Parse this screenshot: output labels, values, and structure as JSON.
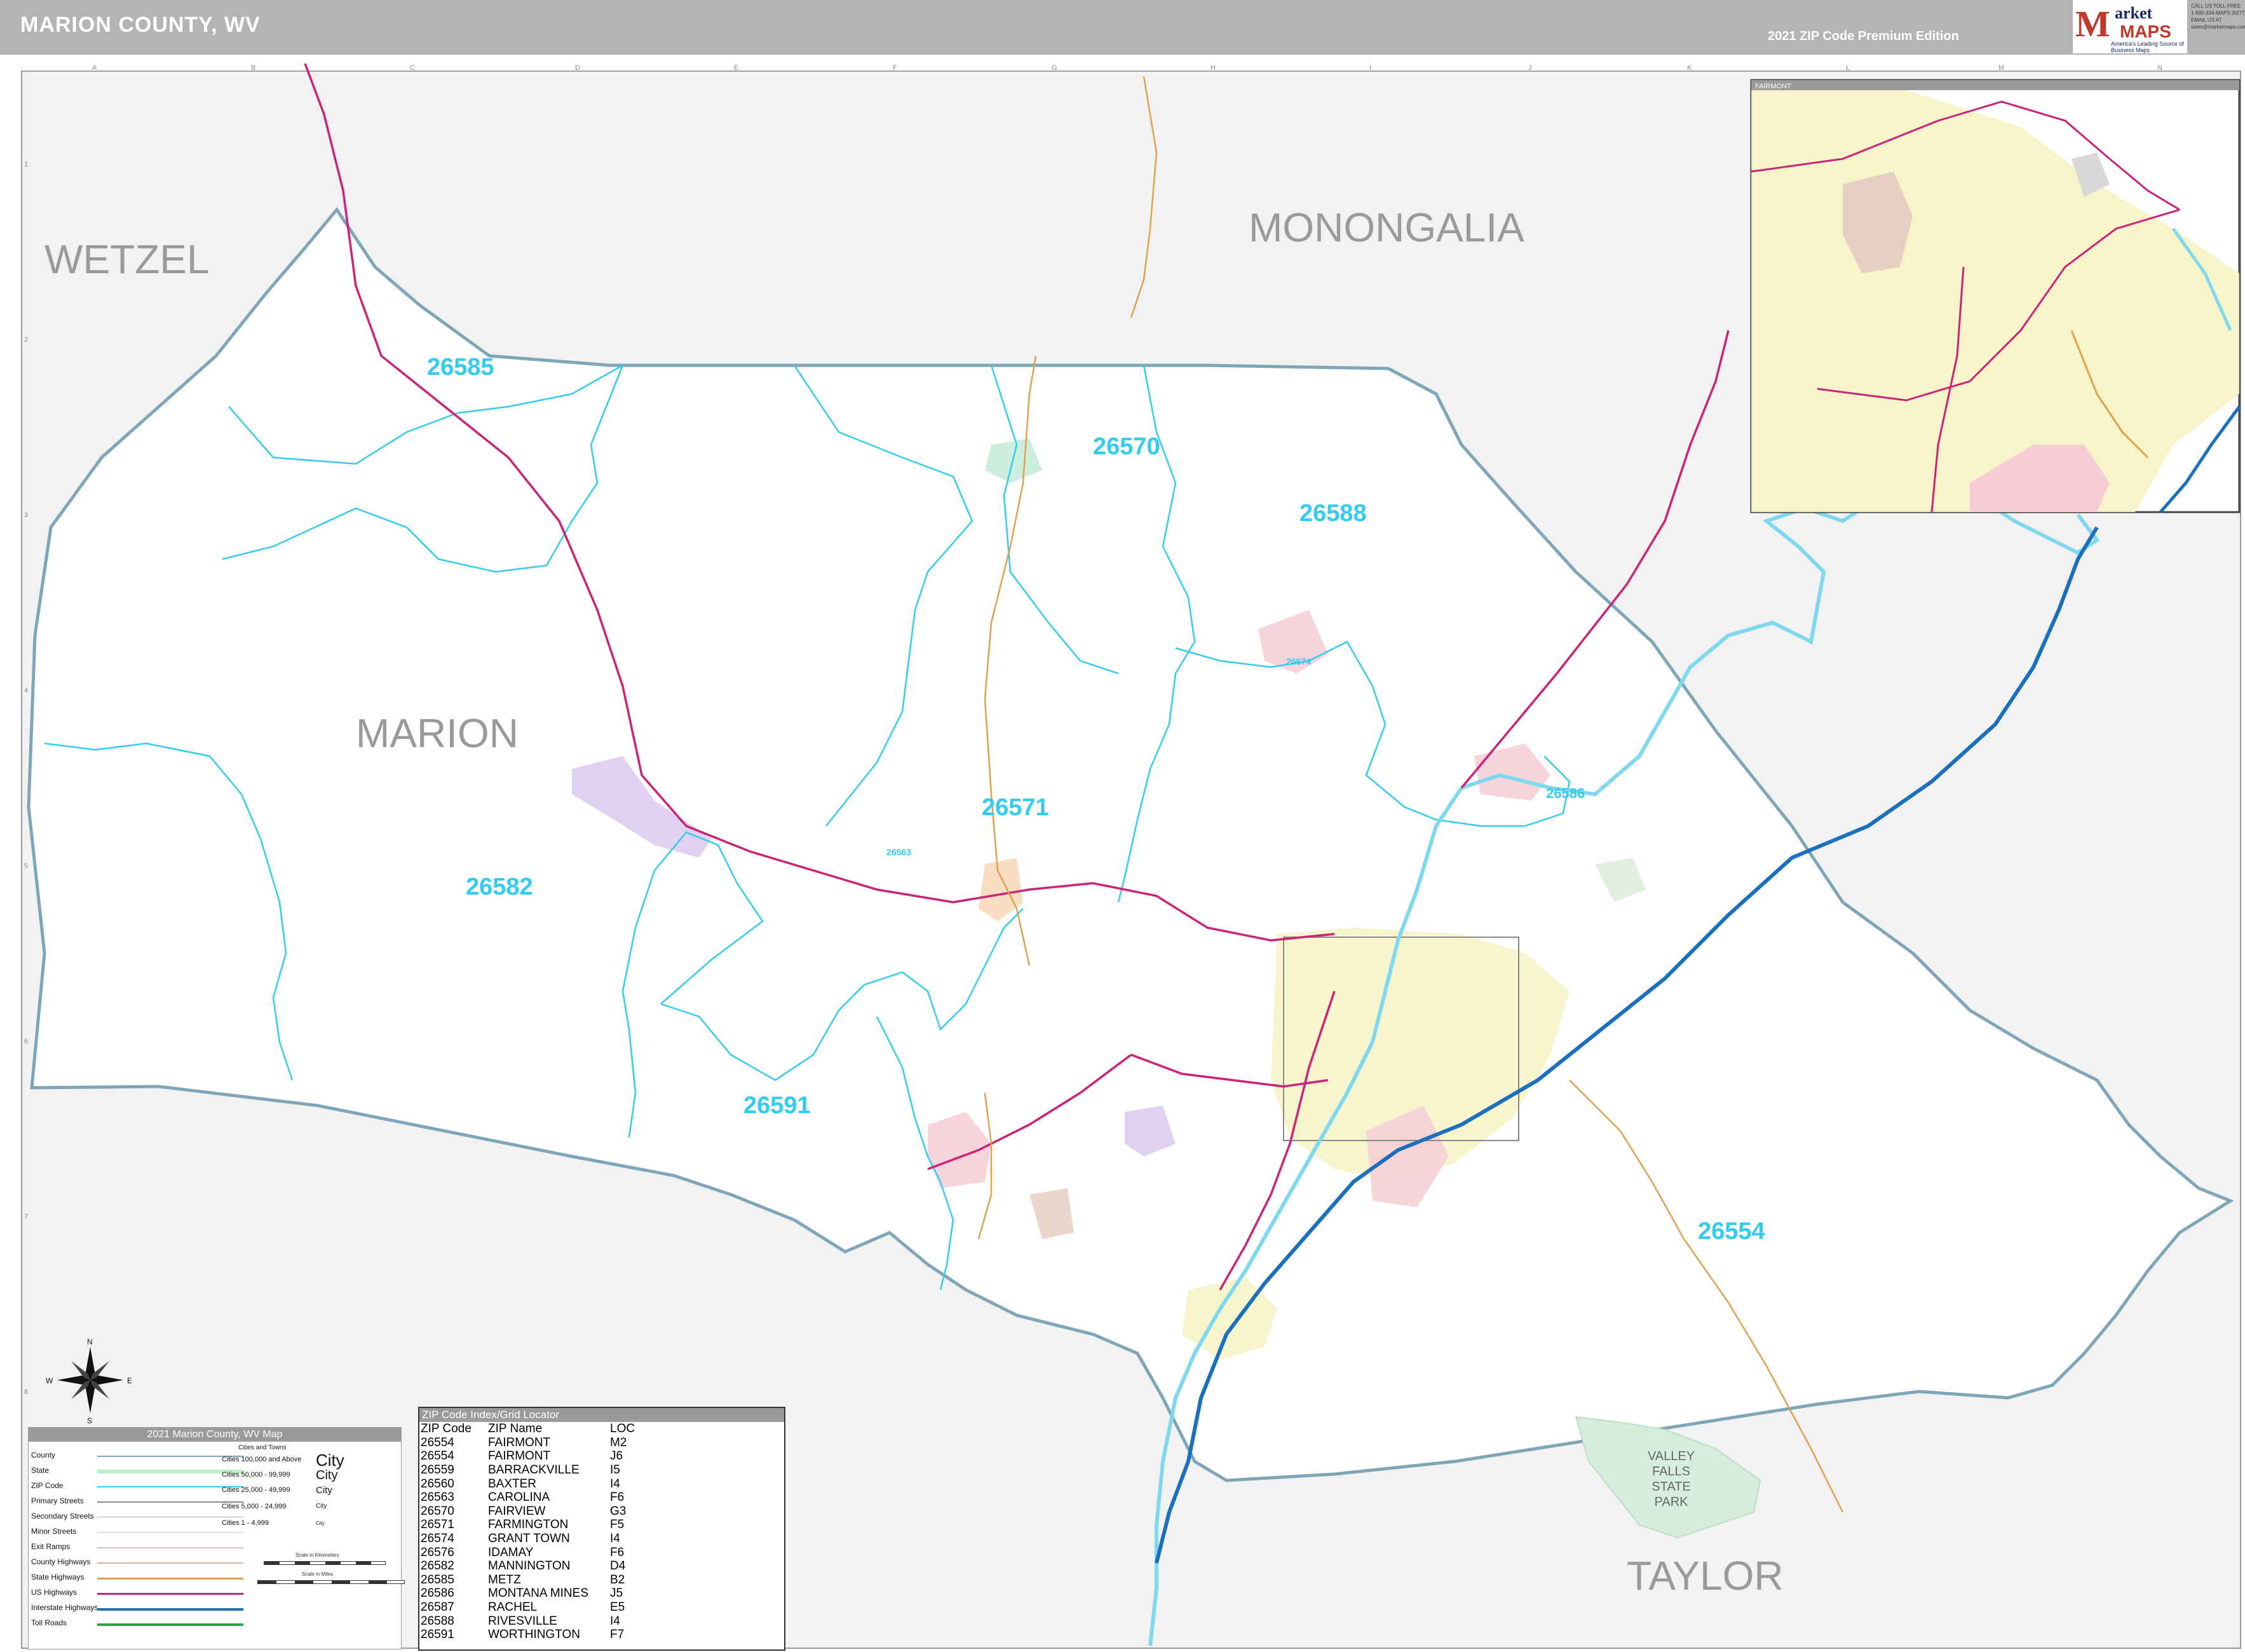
{
  "header": {
    "title": "MARION COUNTY, WV",
    "edition": "2021 ZIP Code Premium Edition",
    "logo": {
      "mark": "M",
      "brand_top": "arket",
      "brand_bottom": "MAPS",
      "tagline": "America's Leading Source of Business Maps"
    },
    "contact": [
      "CALL US TOLL FREE",
      "1-800-334-MAPS (6277)",
      "EMAIL US AT",
      "sales@marketmaps.com"
    ]
  },
  "map": {
    "county_labels": {
      "wetzel": "WETZEL",
      "monongalia": "MONONGALIA",
      "marion": "MARION",
      "taylor": "TAYLOR"
    },
    "zip_labels": [
      "26585",
      "26570",
      "26588",
      "26571",
      "26582",
      "26586",
      "26591",
      "26554",
      "26574",
      "26563"
    ],
    "park_label": [
      "VALLEY",
      "FALLS",
      "STATE",
      "PARK"
    ],
    "grid_letters": [
      "A",
      "B",
      "C",
      "D",
      "E",
      "F",
      "G",
      "H",
      "I",
      "J",
      "K",
      "L",
      "M",
      "N"
    ],
    "grid_numbers": [
      "1",
      "2",
      "3",
      "4",
      "5",
      "6",
      "7",
      "8"
    ],
    "inset_title": "FAIRMONT",
    "compass": {
      "n": "N",
      "s": "S",
      "e": "E",
      "w": "W"
    },
    "colors": {
      "county_boundary": "#7fa6b8",
      "zip_boundary": "#33ccee",
      "us_highway": "#cc2277",
      "interstate": "#1a6fbf",
      "state_highway": "#e0a050",
      "river": "#7fd8ee",
      "outside_county": "#f2f2f2",
      "city_fill": "#f6f3c4"
    }
  },
  "legend": {
    "title": "2021 Marion County, WV Map",
    "rows": [
      "County",
      "State",
      "ZIP Code",
      "Primary Streets",
      "Secondary Streets",
      "Minor Streets",
      "Exit Ramps",
      "County Highways",
      "State Highways",
      "US Highways",
      "Interstate Highways",
      "Toll Roads"
    ],
    "cities_header": "Cities and Towns",
    "city_classes": [
      "Cities 100,000 and Above",
      "Cities 50,000 - 99,999",
      "Cities 25,000 - 49,999",
      "Cities 5,000 - 24,999",
      "Cities 1 - 4,999"
    ],
    "city_samples": [
      "City",
      "City",
      "City",
      "City",
      "City"
    ],
    "scale_km": "Scale in Kilometers",
    "scale_mi": "Scale in Miles"
  },
  "zip_index": {
    "title": "ZIP Code Index/Grid Locator",
    "headers": [
      "ZIP Code",
      "ZIP Name",
      "LOC"
    ],
    "rows": [
      [
        "26554",
        "FAIRMONT",
        "M2"
      ],
      [
        "26554",
        "FAIRMONT",
        "J6"
      ],
      [
        "26559",
        "BARRACKVILLE",
        "I5"
      ],
      [
        "26560",
        "BAXTER",
        "I4"
      ],
      [
        "26563",
        "CAROLINA",
        "F6"
      ],
      [
        "26570",
        "FAIRVIEW",
        "G3"
      ],
      [
        "26571",
        "FARMINGTON",
        "F5"
      ],
      [
        "26574",
        "GRANT TOWN",
        "I4"
      ],
      [
        "26576",
        "IDAMAY",
        "F6"
      ],
      [
        "26582",
        "MANNINGTON",
        "D4"
      ],
      [
        "26585",
        "METZ",
        "B2"
      ],
      [
        "26586",
        "MONTANA MINES",
        "J5"
      ],
      [
        "26587",
        "RACHEL",
        "E5"
      ],
      [
        "26588",
        "RIVESVILLE",
        "I4"
      ],
      [
        "26591",
        "WORTHINGTON",
        "F7"
      ]
    ]
  }
}
